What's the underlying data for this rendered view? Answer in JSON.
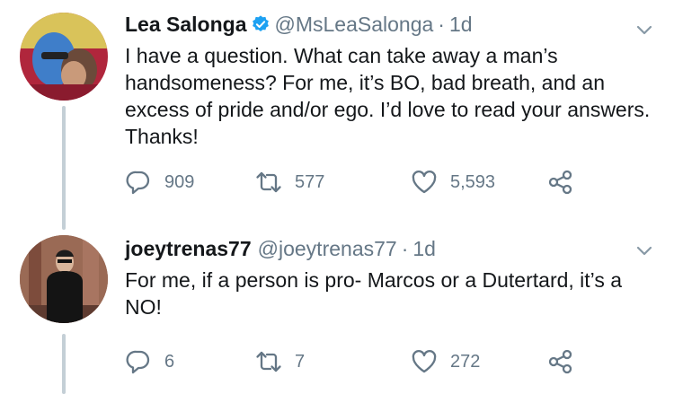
{
  "tweets": [
    {
      "name": "Lea Salonga",
      "verified": true,
      "handle": "@MsLeaSalonga",
      "separator": "·",
      "time": "1d",
      "text": "I have a question. What can take away a man’s handsomeness? For me, it’s BO, bad breath, and an excess of pride and/or ego. I’d love to read your answers. Thanks!",
      "replies": "909",
      "retweets": "577",
      "likes": "5,593"
    },
    {
      "name": "joeytrenas77",
      "verified": false,
      "handle": "@joeytrenas77",
      "separator": "·",
      "time": "1d",
      "text": "For me, if a person is pro- Marcos or a Dutertard, it’s a NO!",
      "replies": "6",
      "retweets": "7",
      "likes": "272"
    }
  ],
  "icons": {
    "reply": "reply-icon",
    "retweet": "retweet-icon",
    "like": "heart-icon",
    "share": "share-icon",
    "caret": "chevron-down-icon",
    "verified": "verified-badge-icon"
  },
  "colors": {
    "text": "#14171a",
    "secondary": "#657786",
    "verified": "#1da1f2",
    "thread_line": "#c4cfd6"
  }
}
